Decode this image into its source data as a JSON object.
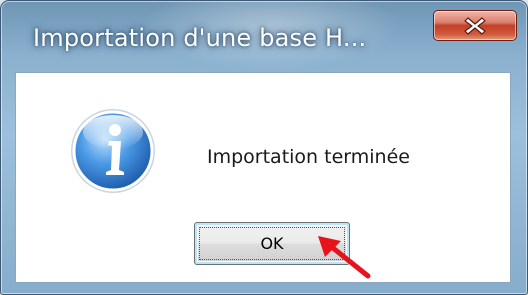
{
  "window": {
    "title": "Importation d'une base H...",
    "close_icon": "close-x-icon"
  },
  "dialog": {
    "icon": "information-icon",
    "message": "Importation terminée",
    "ok_label": "OK"
  },
  "annotation": {
    "icon": "red-arrow-pointer",
    "color": "#e8121a"
  },
  "colors": {
    "titlebar": "#8ab0ce",
    "close_button": "#c23f26",
    "client_bg": "#ffffff",
    "info_blue": "#2f7fd0"
  }
}
